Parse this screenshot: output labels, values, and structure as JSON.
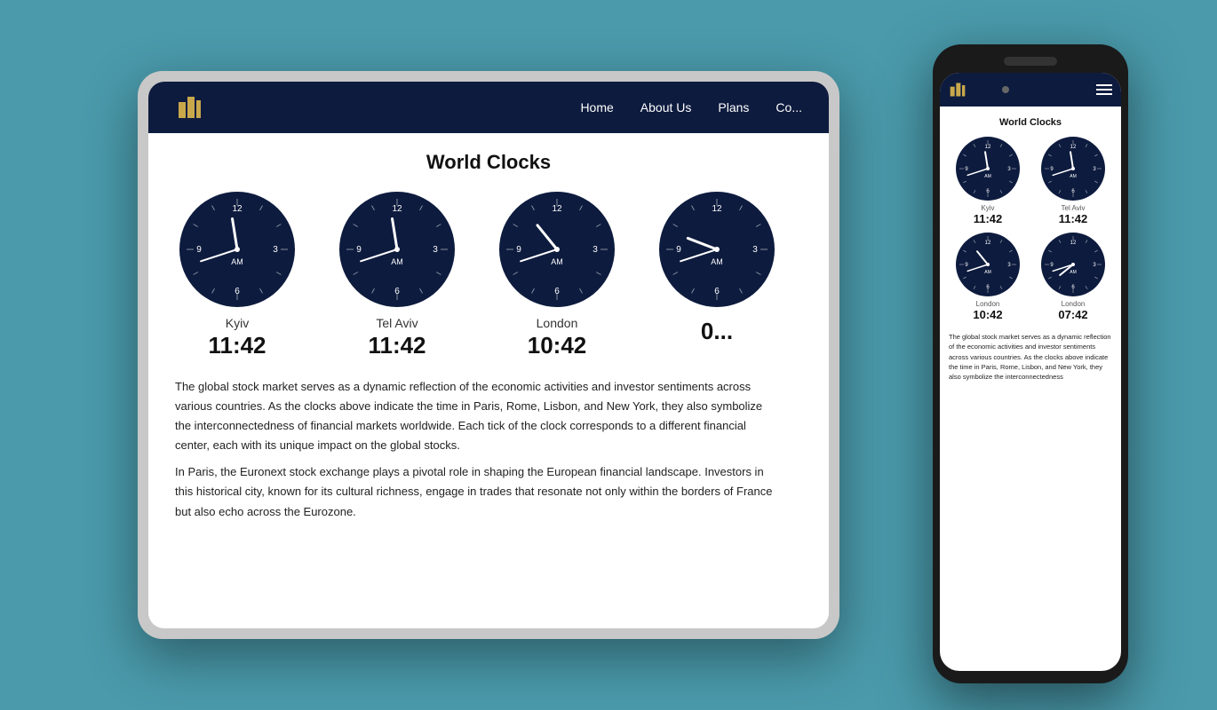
{
  "tablet": {
    "nav": {
      "links": [
        "Home",
        "About Us",
        "Plans",
        "Co..."
      ]
    },
    "world_clocks_title": "World Clocks",
    "clocks": [
      {
        "city": "Kyiv",
        "time": "11:42",
        "am_pm": "AM",
        "hour_angle": 330,
        "minute_angle": 252
      },
      {
        "city": "Tel Aviv",
        "time": "11:42",
        "am_pm": "AM",
        "hour_angle": 330,
        "minute_angle": 252
      },
      {
        "city": "London",
        "time": "10:42",
        "am_pm": "AM",
        "hour_angle": 300,
        "minute_angle": 252
      },
      {
        "city": "",
        "time": "0...",
        "am_pm": "AM",
        "hour_angle": 300,
        "minute_angle": 252
      }
    ],
    "body_text_1": "The global stock market serves as a dynamic reflection of the economic activities and investor sentiments across various countries. As the clocks above indicate the time in Paris, Rome, Lisbon, and New York, they also symbolize the interconnectedness of financial markets worldwide. Each tick of the clock corresponds to a different financial center, each with its unique impact on the global stocks.",
    "body_text_2": "In Paris, the Euronext stock exchange plays a pivotal role in shaping the European financial landscape. Investors in this historical city, known for its cultural richness, engage in trades that resonate not only within the borders of France but also echo across the Eurozone."
  },
  "phone": {
    "title": "World Clocks",
    "clocks": [
      {
        "city": "Kyiv",
        "time": "11:42",
        "hour_angle": 330,
        "minute_angle": 252
      },
      {
        "city": "Tel Aviv",
        "time": "11:42",
        "hour_angle": 330,
        "minute_angle": 252
      },
      {
        "city": "London",
        "time": "10:42",
        "hour_angle": 300,
        "minute_angle": 252
      },
      {
        "city": "London",
        "time": "07:42",
        "hour_angle": 225,
        "minute_angle": 252
      }
    ],
    "body_text": "The global stock market serves as a dynamic reflection of the economic activities and investor sentiments across various countries. As the clocks above indicate the time in Paris, Rome, Lisbon, and New York, they also symbolize the interconnectedness"
  },
  "logo_color": "#c9a84c",
  "nav_bg": "#0d1b3e"
}
